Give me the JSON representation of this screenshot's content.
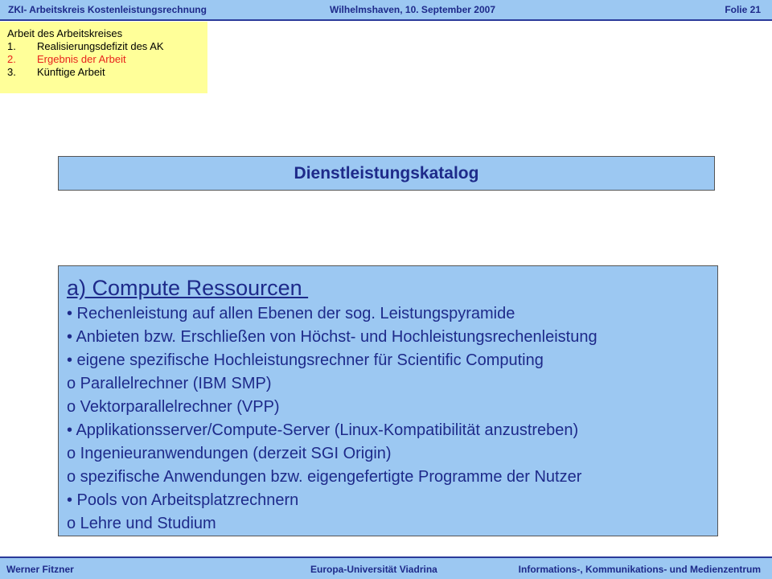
{
  "header": {
    "left": "ZKI- Arbeitskreis Kostenleistungsrechnung",
    "center": "Wilhelmshaven, 10. September 2007",
    "right": "Folie 21"
  },
  "agenda": {
    "title": "Arbeit des Arbeitskreises",
    "items": [
      {
        "number": "1.",
        "label": "Realisierungsdefizit des AK"
      },
      {
        "number": "2.",
        "label": "Ergebnis der Arbeit"
      },
      {
        "number": "3.",
        "label": "Künftige Arbeit"
      }
    ],
    "active_color": "#e8231c"
  },
  "title": "Dienstleistungskatalog",
  "content": {
    "heading": "a) Compute Ressourcen ",
    "lines": [
      "• Rechenleistung auf allen Ebenen der sog. Leistungspyramide",
      "• Anbieten bzw. Erschließen von Höchst- und Hochleistungsrechenleistung",
      "• eigene spezifische Hochleistungsrechner für Scientific Computing",
      "o Parallelrechner (IBM SMP)",
      "o Vektorparallelrechner (VPP)",
      "• Applikationsserver/Compute-Server (Linux-Kompatibilität anzustreben)",
      "o Ingenieuranwendungen (derzeit SGI Origin)",
      "o spezifische Anwendungen bzw. eigengefertigte Programme der Nutzer",
      "• Pools von Arbeitsplatzrechnern",
      "o Lehre und Studium"
    ]
  },
  "footer": {
    "left": "Werner Fitzner",
    "center": "Europa-Universität Viadrina",
    "right": "Informations-, Kommunikations- und Medienzentrum"
  },
  "colors": {
    "bar_background": "#9cc8f2",
    "text_blue": "#1e2a8a",
    "agenda_background": "#ffff99"
  }
}
